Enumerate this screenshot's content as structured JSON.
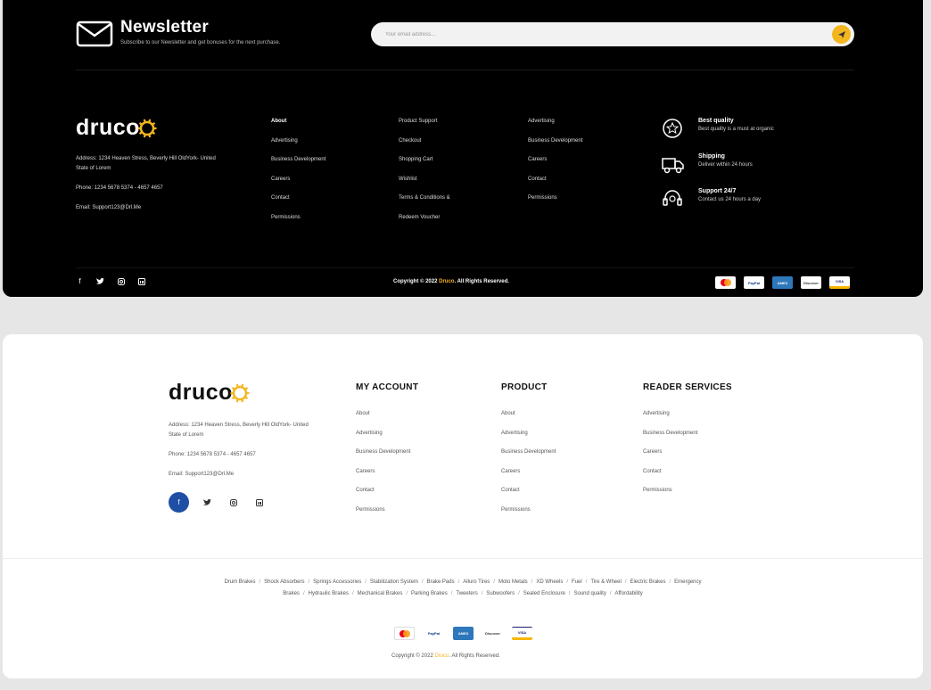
{
  "newsletter": {
    "title": "Newsletter",
    "subtitle": "Subscribe to our Newsletter and get bonuses for the next purchase.",
    "placeholder": "Your email address..."
  },
  "brand": {
    "logo_text": "druco",
    "accent_color": "#f4b61f",
    "address": "Address: 1234 Heaven Stress, Beverly Hill OldYork- United State of Lorem",
    "phone": "Phone: 1234 5678 5374 - 4657 4657",
    "email": "Email: Support123@Drl.Me"
  },
  "dark_footer": {
    "col1": [
      "About",
      "Advertising",
      "Business Development",
      "Careers",
      "Contact",
      "Permissions"
    ],
    "col2": [
      "Product Support",
      "Checkout",
      "Shopping Cart",
      "Wishlist",
      "Terms & Conditions &",
      "Redeem Voucher"
    ],
    "col3": [
      "Advertising",
      "Business Development",
      "Careers",
      "Contact",
      "Permissions"
    ],
    "features": [
      {
        "title": "Best quality",
        "desc": "Best quality is a must at organic",
        "icon": "badge-star-icon"
      },
      {
        "title": "Shipping",
        "desc": "Deliver within 24 hours",
        "icon": "truck-icon"
      },
      {
        "title": "Support 24/7",
        "desc": "Contact us 24 hours a day",
        "icon": "headset-icon"
      }
    ],
    "copyright_prefix": "Copyright © 2022",
    "copyright_brand": "Druco",
    "copyright_suffix": ". All Rights Reserved."
  },
  "light_footer": {
    "headings": [
      "MY ACCOUNT",
      "PRODUCT",
      "READER SERVICES"
    ],
    "col1": [
      "About",
      "Advertising",
      "Business Development",
      "Careers",
      "Contact",
      "Permissions"
    ],
    "col2": [
      "About",
      "Advertising",
      "Business Development",
      "Careers",
      "Contact",
      "Permissions"
    ],
    "col3": [
      "Advertising",
      "Business Development",
      "Careers",
      "Contact",
      "Permissions"
    ],
    "tags": [
      "Drum Brakes",
      "Shock Absorbers",
      "Springs Accessories",
      "Stabilization System",
      "Brake Pads",
      "Alluro Tires",
      "Moto Metals",
      "XD Wheels",
      "Fuel",
      "Tire & Wheel",
      "Electric Brakes",
      "Emergency Brakes",
      "Hydraulic Brakes",
      "Mechanical Brakes",
      "Parking Brakes",
      "Tweeters",
      "Subwoofers",
      "Sealed Enclosure",
      "Sound quality",
      "Affordability"
    ],
    "copyright_prefix": "Copyright © 2022",
    "copyright_brand": "Druco",
    "copyright_suffix": ". All Rights Reserved."
  },
  "payments": [
    {
      "label": "MC",
      "icon": "mastercard-icon"
    },
    {
      "label": "PayPal",
      "icon": "paypal-icon"
    },
    {
      "label": "AMEX",
      "icon": "amex-icon"
    },
    {
      "label": "Discover",
      "icon": "discover-icon"
    },
    {
      "label": "VISA",
      "icon": "visa-icon"
    }
  ],
  "social": [
    "facebook-icon",
    "twitter-icon",
    "instagram-icon",
    "linkedin-icon"
  ]
}
